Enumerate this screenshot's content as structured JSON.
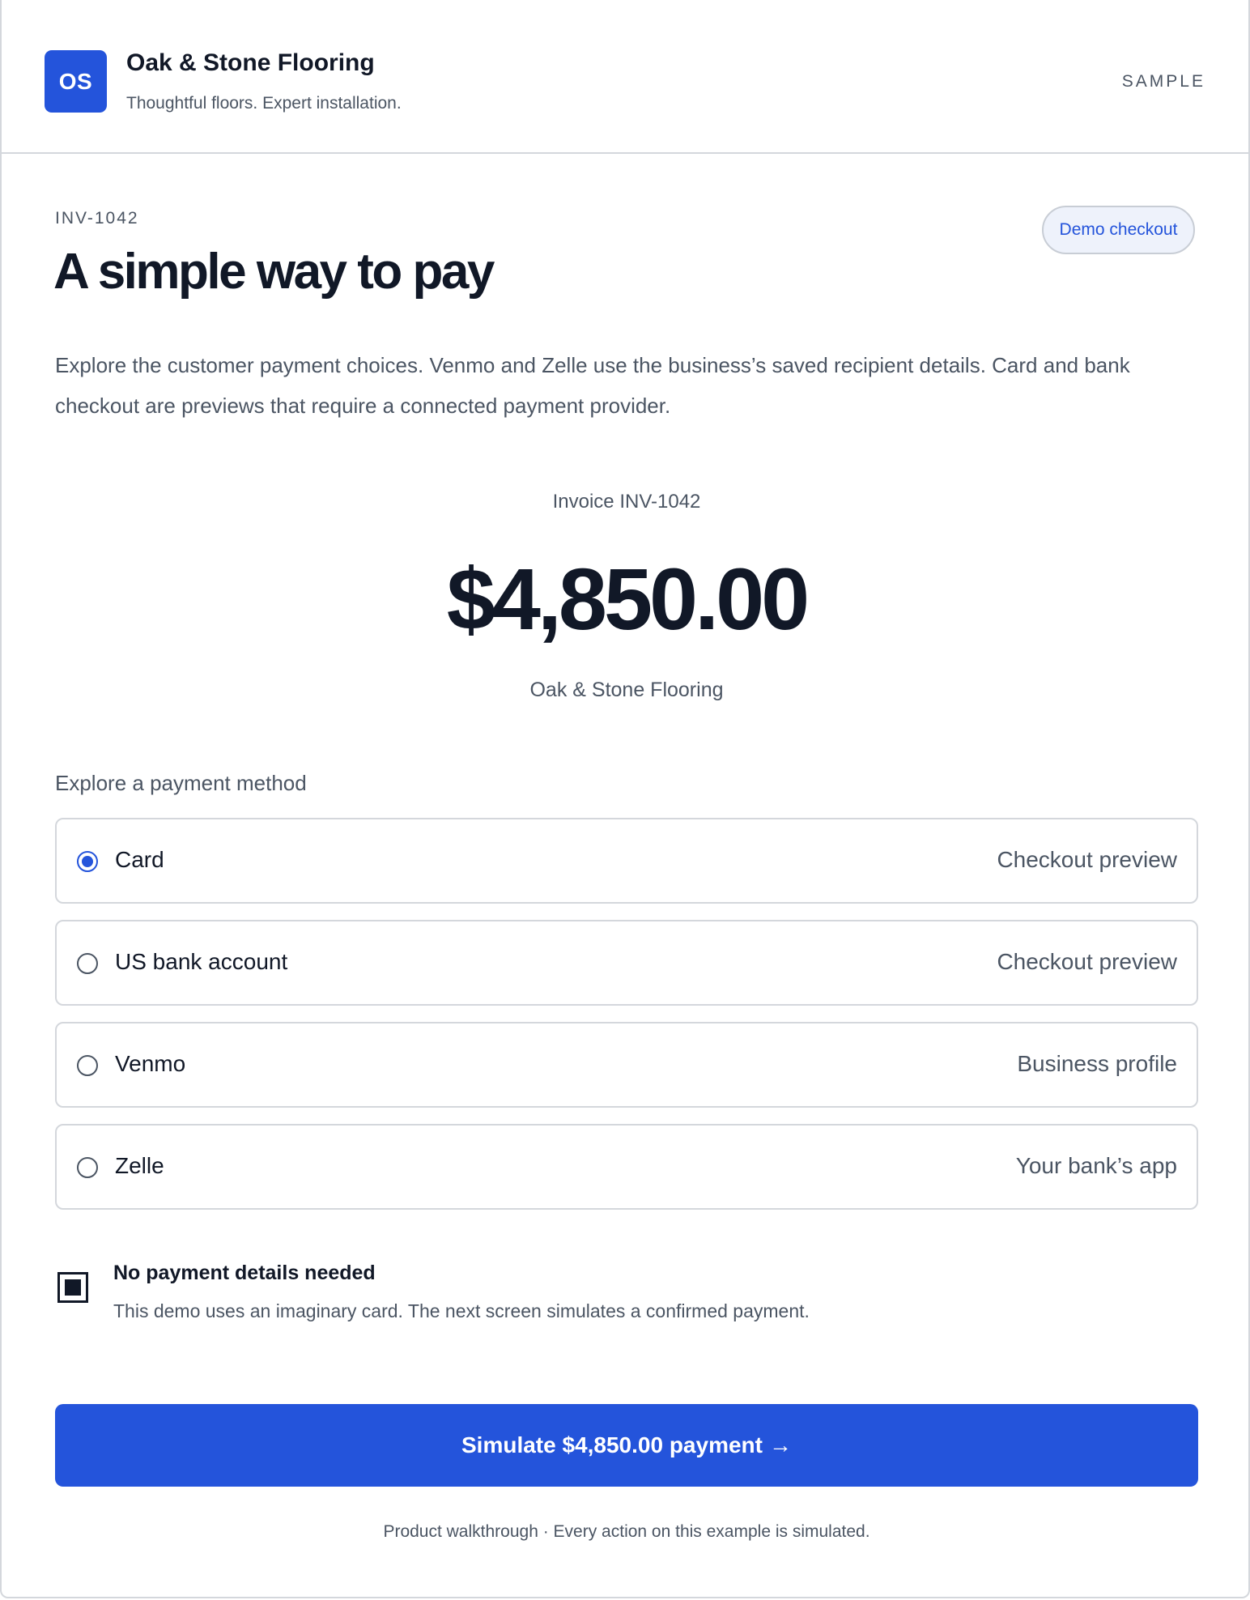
{
  "header": {
    "logo_initials": "OS",
    "company_name": "Oak & Stone Flooring",
    "tagline": "Thoughtful floors. Expert installation.",
    "sample_label": "SAMPLE"
  },
  "main": {
    "invoice_code": "INV-1042",
    "badge": "Demo checkout",
    "title": "A simple way to pay",
    "intro": "Explore the customer payment choices. Venmo and Zelle use the business’s saved recipient details. Card and bank checkout are previews that require a connected payment provider.",
    "invoice_label": "Invoice INV-1042",
    "amount": "$4,850.00",
    "payee": "Oak & Stone Flooring"
  },
  "payment_methods": {
    "label": "Explore a payment method",
    "selected": "Card",
    "items": [
      {
        "name": "Card",
        "note": "Checkout preview"
      },
      {
        "name": "US bank account",
        "note": "Checkout preview"
      },
      {
        "name": "Venmo",
        "note": "Business profile"
      },
      {
        "name": "Zelle",
        "note": "Your bank’s app"
      }
    ]
  },
  "notice": {
    "title": "No payment details needed",
    "text": "This demo uses an imaginary card. The next screen simulates a confirmed payment."
  },
  "pay_button": {
    "label": "Simulate $4,850.00 payment",
    "arrow": "→"
  },
  "footer": {
    "note": "Product walkthrough · Every action on this example is simulated."
  },
  "colors": {
    "accent": "#2454db",
    "text": "#111827",
    "muted": "#4b5563",
    "border": "#d4d7dc"
  }
}
